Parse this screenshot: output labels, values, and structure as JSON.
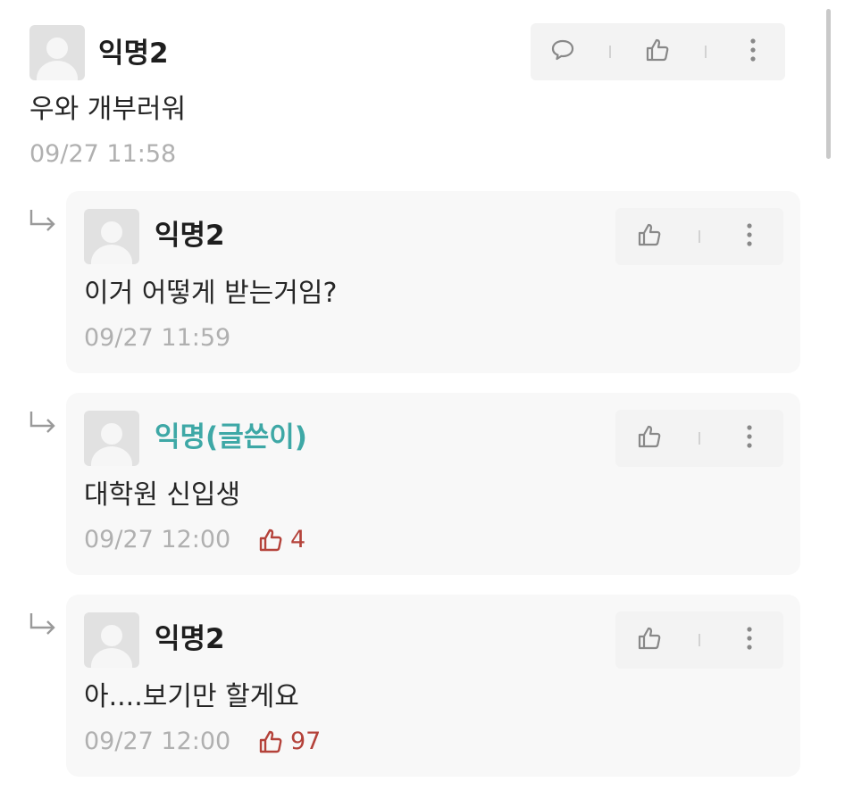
{
  "comments": [
    {
      "author": "익명2",
      "content": "우와 개부러워",
      "timestamp": "09/27 11:58",
      "icons": [
        "speech-bubble-icon",
        "thumbs-up-icon",
        "more-vertical-icon"
      ]
    }
  ],
  "replies": [
    {
      "author": "익명2",
      "content": "이거 어떻게 받는거임?",
      "timestamp": "09/27 11:59",
      "likes": null
    },
    {
      "author": "익명(글쓴이)",
      "is_author": true,
      "content": "대학원 신입생",
      "timestamp": "09/27 12:00",
      "likes": "4"
    },
    {
      "author": "익명2",
      "content": "아....보기만 할게요",
      "timestamp": "09/27 12:00",
      "likes": "97"
    }
  ],
  "colors": {
    "author_name": "#3ea8a6",
    "like_count": "#b4423a",
    "meta": "#b0b0b0",
    "reply_background": "#f8f8f8",
    "action_background": "#f3f3f3"
  }
}
